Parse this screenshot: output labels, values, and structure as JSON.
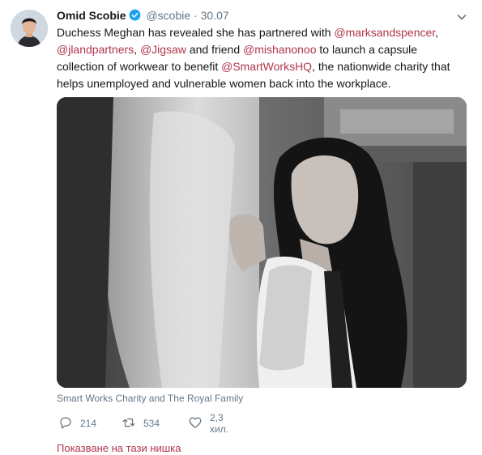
{
  "tweet": {
    "author_name": "Omid Scobie",
    "handle": "@scobie",
    "separator": "·",
    "date": "30.07",
    "text_parts": [
      {
        "text": "Duchess Meghan has revealed she has partnered with ",
        "mention": false
      },
      {
        "text": "@marksandspencer",
        "mention": true
      },
      {
        "text": ", ",
        "mention": false
      },
      {
        "text": "@jlandpartners",
        "mention": true
      },
      {
        "text": ", ",
        "mention": false
      },
      {
        "text": "@Jigsaw",
        "mention": true
      },
      {
        "text": " and friend ",
        "mention": false
      },
      {
        "text": "@mishanonoo",
        "mention": true
      },
      {
        "text": " to launch a capsule collection of workwear to benefit ",
        "mention": false
      },
      {
        "text": "@SmartWorksHQ",
        "mention": true
      },
      {
        "text": ", the nationwide charity that helps unemployed and vulnerable women back into the workplace.",
        "mention": false
      }
    ],
    "media_caption": "Smart Works Charity and The Royal Family",
    "replies_count": "214",
    "retweets_count": "534",
    "likes_count": "2,3 хил.",
    "show_thread_label": "Показване на тази нишка"
  },
  "colors": {
    "accent": "#b0354a",
    "muted": "#657786",
    "verified": "#1da1f2"
  },
  "icons": {
    "verified": "verified-badge-icon",
    "menu": "chevron-down-icon",
    "reply": "reply-icon",
    "retweet": "retweet-icon",
    "like": "heart-icon"
  }
}
